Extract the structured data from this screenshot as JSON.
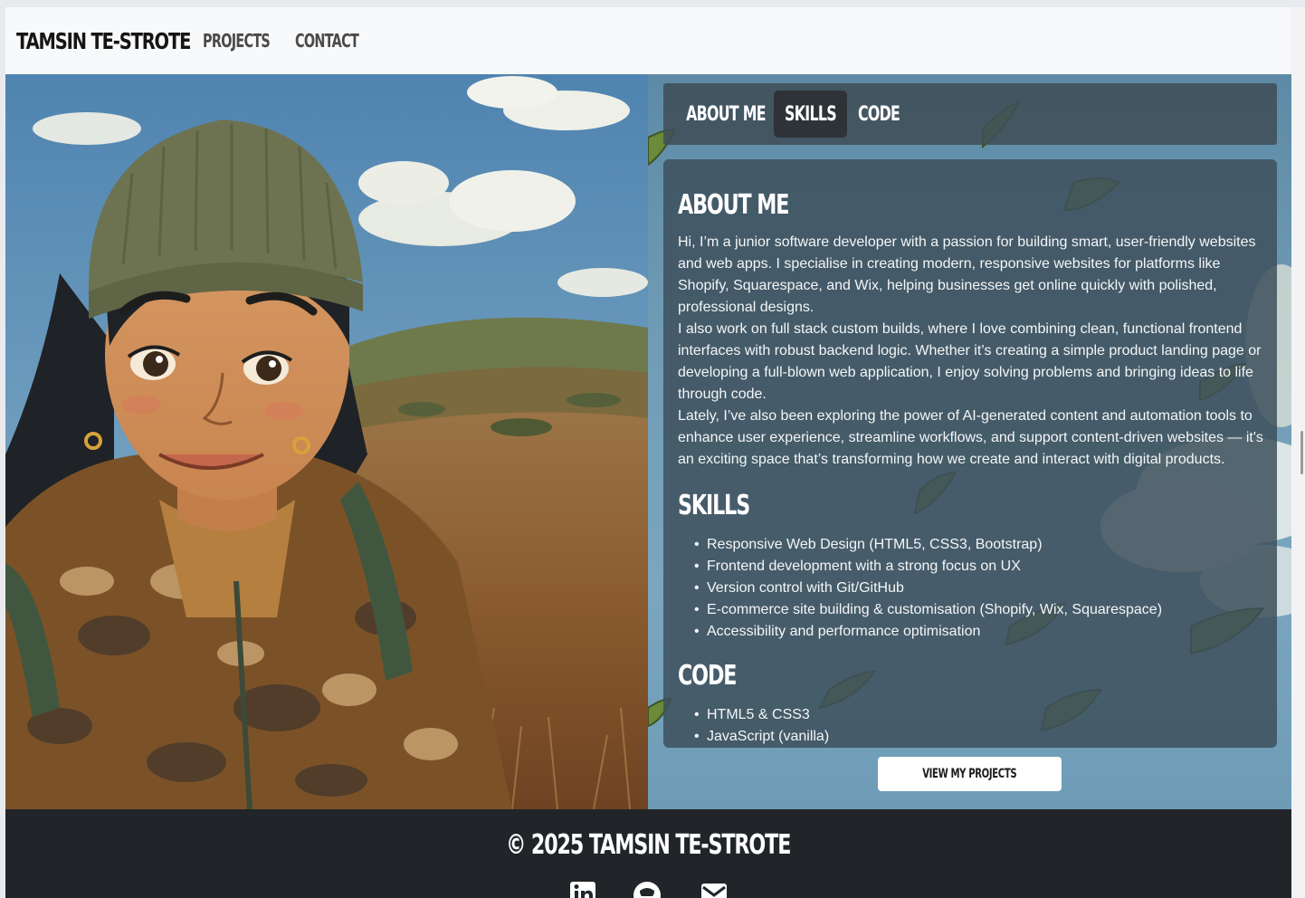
{
  "nav": {
    "brand": "TAMSIN TE-STROTE",
    "links": [
      "PROJECTS",
      "CONTACT"
    ]
  },
  "tabs": [
    {
      "label": "ABOUT ME",
      "active": false
    },
    {
      "label": "SKILLS",
      "active": true
    },
    {
      "label": "CODE",
      "active": false
    }
  ],
  "about": {
    "heading": "ABOUT ME",
    "paragraphs": [
      "Hi, I’m a junior software developer with a passion for building smart, user-friendly websites and web apps. I specialise in creating modern, responsive websites for platforms like Shopify, Squarespace, and Wix, helping businesses get online quickly with polished, professional designs.",
      "I also work on full stack custom builds, where I love combining clean, functional frontend interfaces with robust backend logic. Whether it’s creating a simple product landing page or developing a full-blown web application, I enjoy solving problems and bringing ideas to life through code.",
      "Lately, I’ve also been exploring the power of AI-generated content and automation tools to enhance user experience, streamline workflows, and support content-driven websites — it's an exciting space that’s transforming how we create and interact with digital products."
    ]
  },
  "skills": {
    "heading": "SKILLS",
    "items": [
      "Responsive Web Design (HTML5, CSS3, Bootstrap)",
      "Frontend development with a strong focus on UX",
      "Version control with Git/GitHub",
      "E-commerce site building & customisation (Shopify, Wix, Squarespace)",
      "Accessibility and performance optimisation"
    ]
  },
  "code": {
    "heading": "CODE",
    "items": [
      "HTML5 & CSS3",
      "JavaScript (vanilla)"
    ]
  },
  "cta": {
    "label": "VIEW MY PROJECTS"
  },
  "footer": {
    "copyright": "© 2025 TAMSIN TE-STROTE",
    "socials": [
      "linkedin-icon",
      "github-icon",
      "email-icon"
    ]
  },
  "colors": {
    "footer_bg": "#212529",
    "panel": "#3e505c",
    "active_tab": "#2e3337"
  }
}
